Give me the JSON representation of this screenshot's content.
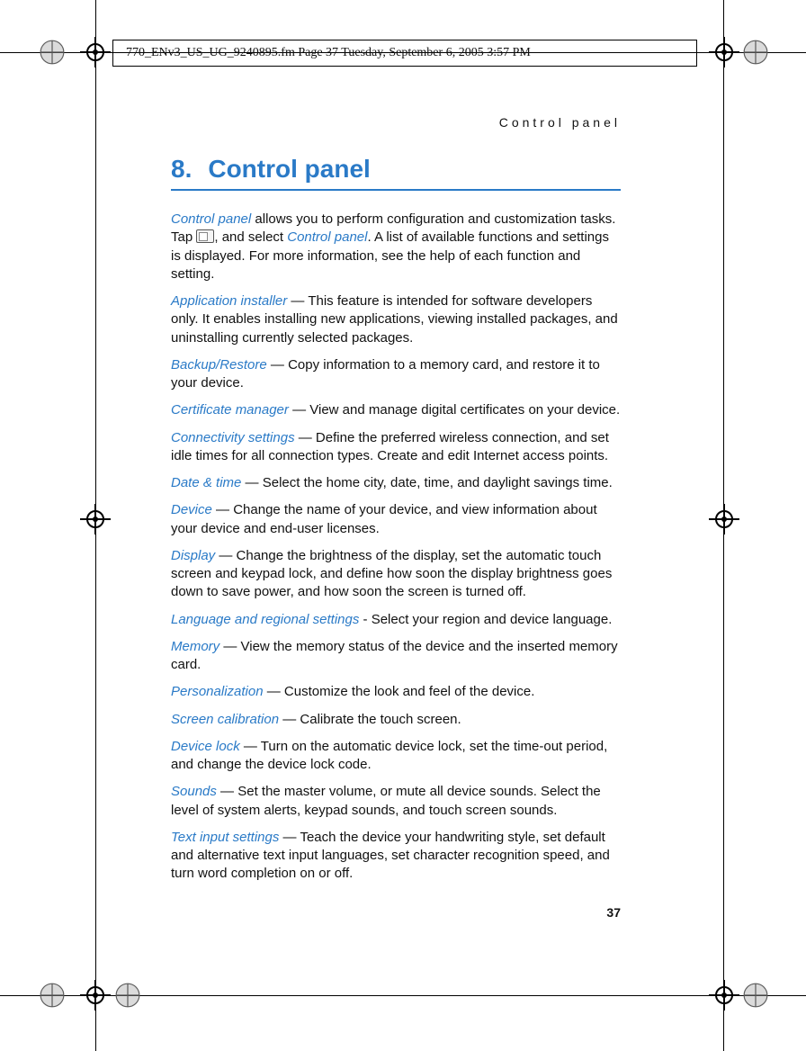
{
  "header": {
    "line": "770_ENv3_US_UG_9240895.fm  Page 37  Tuesday, September 6, 2005  3:57 PM"
  },
  "running_head": "Control panel",
  "chapter": {
    "number": "8.",
    "title": "Control panel"
  },
  "intro": {
    "term": "Control panel",
    "pre": " allows you to perform configuration and customization tasks. Tap ",
    "mid": ", and select ",
    "term2": "Control panel",
    "post": ". A list of available functions and settings is displayed. For more information, see the help of each function and setting."
  },
  "items": [
    {
      "term": "Application installer",
      "sep": " — ",
      "desc": "This feature is intended for software developers only. It enables installing new applications, viewing installed packages, and uninstalling currently selected packages."
    },
    {
      "term": "Backup/Restore",
      "sep": " — ",
      "desc": "Copy information to a memory card, and restore it to your device."
    },
    {
      "term": "Certificate manager",
      "sep": " — ",
      "desc": "View and manage digital certificates on your device."
    },
    {
      "term": "Connectivity settings",
      "sep": " — ",
      "desc": "Define the preferred wireless connection, and set idle times for all connection types. Create and edit Internet access points."
    },
    {
      "term": "Date & time",
      "sep": " — ",
      "desc": "Select the home city, date, time, and daylight savings time."
    },
    {
      "term": "Device",
      "sep": " — ",
      "desc": "Change the name of your device, and view information about your device and end-user licenses."
    },
    {
      "term": "Display",
      "sep": " — ",
      "desc": "Change the brightness of the display, set the automatic touch screen and keypad lock, and define how soon the display brightness goes down to save power, and how soon the screen is turned off."
    },
    {
      "term": "Language and regional settings",
      "sep": " - ",
      "desc": "Select your region and device language."
    },
    {
      "term": "Memory",
      "sep": " — ",
      "desc": "View the memory status of the device and the inserted memory card."
    },
    {
      "term": "Personalization",
      "sep": " — ",
      "desc": "Customize the look and feel of the device."
    },
    {
      "term": "Screen calibration",
      "sep": " — ",
      "desc": "Calibrate the touch screen."
    },
    {
      "term": "Device lock",
      "sep": " — ",
      "desc": "Turn on the automatic device lock, set the time-out period, and change the device lock code."
    },
    {
      "term": "Sounds",
      "sep": " — ",
      "desc": "Set the master volume, or mute all device sounds. Select the level of system alerts, keypad sounds, and touch screen sounds."
    },
    {
      "term": "Text input settings",
      "sep": " — ",
      "desc": "Teach the device your handwriting style, set default and alternative text input languages, set character recognition speed, and turn word completion on or off."
    }
  ],
  "page_number": "37"
}
